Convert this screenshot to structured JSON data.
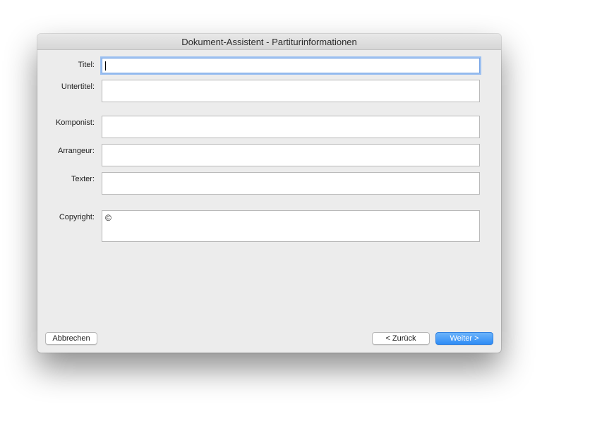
{
  "window": {
    "title": "Dokument-Assistent - Partiturinformationen"
  },
  "form": {
    "title_label": "Titel:",
    "title_value": "",
    "subtitle_label": "Untertitel:",
    "subtitle_value": "",
    "composer_label": "Komponist:",
    "composer_value": "",
    "arranger_label": "Arrangeur:",
    "arranger_value": "",
    "lyricist_label": "Texter:",
    "lyricist_value": "",
    "copyright_label": "Copyright:",
    "copyright_value": "©"
  },
  "buttons": {
    "cancel": "Abbrechen",
    "back": "< Zurück",
    "next": "Weiter >"
  },
  "colors": {
    "accent": "#2f8cf5",
    "focus_ring": "#9cc0f0",
    "window_bg": "#ececec"
  }
}
